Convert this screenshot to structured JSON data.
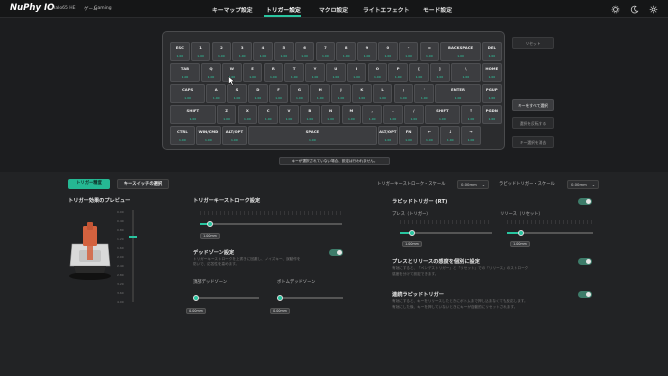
{
  "header": {
    "brand": "NuPhy IO",
    "device": "Halo65 HE",
    "mode_prefix": "ゲーム",
    "mode": "Gaming",
    "tabs": [
      "キーマップ設定",
      "トリガー設定",
      "マクロ設定",
      "ライトエフェクト",
      "モード設定"
    ],
    "active_tab": "トリガー設定",
    "icons": [
      "gear-icon",
      "theme-moon-icon",
      "settings-icon"
    ]
  },
  "keyboard": {
    "accent_color": "#2fd3a7",
    "rows": [
      [
        {
          "l": "ESC",
          "v": "1.00"
        },
        {
          "l": "1",
          "v": "1.00"
        },
        {
          "l": "2",
          "v": "1.00"
        },
        {
          "l": "3",
          "v": "1.00"
        },
        {
          "l": "4",
          "v": "1.00"
        },
        {
          "l": "5",
          "v": "1.00"
        },
        {
          "l": "6",
          "v": "1.00"
        },
        {
          "l": "7",
          "v": "1.00"
        },
        {
          "l": "8",
          "v": "1.00"
        },
        {
          "l": "9",
          "v": "1.00"
        },
        {
          "l": "0",
          "v": "1.00"
        },
        {
          "l": "-",
          "v": "1.00"
        },
        {
          "l": "=",
          "v": "1.00"
        },
        {
          "l": "BACKSPACE",
          "v": "1.00"
        },
        {
          "l": "DEL",
          "v": "1.00"
        }
      ],
      [
        {
          "l": "TAB",
          "v": "1.00"
        },
        {
          "l": "Q",
          "v": "1.00"
        },
        {
          "l": "W",
          "v": "1.00"
        },
        {
          "l": "E",
          "v": "1.00"
        },
        {
          "l": "R",
          "v": "1.00"
        },
        {
          "l": "T",
          "v": "1.00"
        },
        {
          "l": "Y",
          "v": "1.00"
        },
        {
          "l": "U",
          "v": "1.00"
        },
        {
          "l": "I",
          "v": "1.00"
        },
        {
          "l": "O",
          "v": "1.00"
        },
        {
          "l": "P",
          "v": "1.00"
        },
        {
          "l": "[",
          "v": "1.00"
        },
        {
          "l": "]",
          "v": "1.00"
        },
        {
          "l": "\\",
          "v": "1.00"
        },
        {
          "l": "HOME",
          "v": "1.00"
        }
      ],
      [
        {
          "l": "CAPS",
          "v": "1.00"
        },
        {
          "l": "A",
          "v": "1.00"
        },
        {
          "l": "S",
          "v": "1.00"
        },
        {
          "l": "D",
          "v": "1.00"
        },
        {
          "l": "F",
          "v": "1.00"
        },
        {
          "l": "G",
          "v": "1.00"
        },
        {
          "l": "H",
          "v": "1.00"
        },
        {
          "l": "J",
          "v": "1.00"
        },
        {
          "l": "K",
          "v": "1.00"
        },
        {
          "l": "L",
          "v": "1.00"
        },
        {
          "l": ";",
          "v": "1.00"
        },
        {
          "l": "'",
          "v": "1.00"
        },
        {
          "l": "ENTER",
          "v": "1.00"
        },
        {
          "l": "PGUP",
          "v": "1.00"
        }
      ],
      [
        {
          "l": "SHIFT",
          "v": "1.00"
        },
        {
          "l": "Z",
          "v": "1.00"
        },
        {
          "l": "X",
          "v": "1.00"
        },
        {
          "l": "C",
          "v": "1.00"
        },
        {
          "l": "V",
          "v": "1.00"
        },
        {
          "l": "B",
          "v": "1.00"
        },
        {
          "l": "N",
          "v": "1.00"
        },
        {
          "l": "M",
          "v": "1.00"
        },
        {
          "l": ",",
          "v": "1.00"
        },
        {
          "l": ".",
          "v": "1.00"
        },
        {
          "l": "/",
          "v": "1.00"
        },
        {
          "l": "SHIFT",
          "v": "1.00"
        },
        {
          "l": "↑",
          "v": "1.00"
        },
        {
          "l": "PGDN",
          "v": "1.00"
        }
      ],
      [
        {
          "l": "CTRL",
          "v": "1.00"
        },
        {
          "l": "WIN/CMD",
          "v": "1.00"
        },
        {
          "l": "ALT/OPT",
          "v": "1.00"
        },
        {
          "l": "SPACE",
          "v": "1.00"
        },
        {
          "l": "ALT/OPT",
          "v": "1.00"
        },
        {
          "l": "FN",
          "v": "1.00"
        },
        {
          "l": "←",
          "v": "1.00"
        },
        {
          "l": "↓",
          "v": "1.00"
        },
        {
          "l": "→",
          "v": "1.00"
        }
      ]
    ]
  },
  "side_buttons": {
    "reset": "リセット",
    "select_all": "キーをすべて選択",
    "invert": "選択を反転する",
    "clear": "キー選択を消去"
  },
  "notice": "キーが選択されていない場合、設定は行われません。",
  "lower": {
    "tab_trigger": "トリガー精度",
    "tab_switch": "キースイッチの選択",
    "preview_title": "トリガー効果のプレビュー",
    "preview_scale": [
      "0.00",
      "0.40",
      "0.80",
      "1.20",
      "1.60",
      "2.00",
      "2.40",
      "2.80",
      "3.20",
      "3.60",
      "4.00"
    ],
    "trigger_stroke_title": "トリガーキーストローク設定",
    "trigger_stroke_value": "1.00mm",
    "deadzone_title": "デッドゾーン設定",
    "deadzone_desc": [
      "トリガーキーストロークを上書きに回避し、ノイズキー、誤動作を",
      "防いで、応答性を高めます。"
    ],
    "top_deadzone_label": "頂部デッドゾーン",
    "top_deadzone_value": "0.00mm",
    "bottom_deadzone_label": "ボトムデッドゾーン",
    "bottom_deadzone_value": "0.00mm",
    "stroke_scale_label": "トリガーキーストローク・スケール",
    "stroke_scale_value": "0.00mm",
    "rapid_scale_label": "ラピッドトリガー・スケール",
    "rapid_scale_value": "0.00mm",
    "rapid_title": "ラピッドトリガー (RT)",
    "press_label": "プレス（トリガー）",
    "press_value": "1.00mm",
    "release_label": "リリース（リセット）",
    "release_value": "1.00mm",
    "separate_title": "プレスとリリースの感度を個別に設定",
    "separate_desc": [
      "有効にすると、「ペンデストリガー」と「リセット」での「リリース」のストローク",
      "感度を分けて設定できます。"
    ],
    "continuous_title": "連続ラピッドトリガー",
    "continuous_desc": [
      "有効にすると、キーをリリースしたときにボトムまで押し込まなくても反応します。",
      "有効にした後、キーを押していないときにキーが自動的にリセットされます。"
    ]
  }
}
